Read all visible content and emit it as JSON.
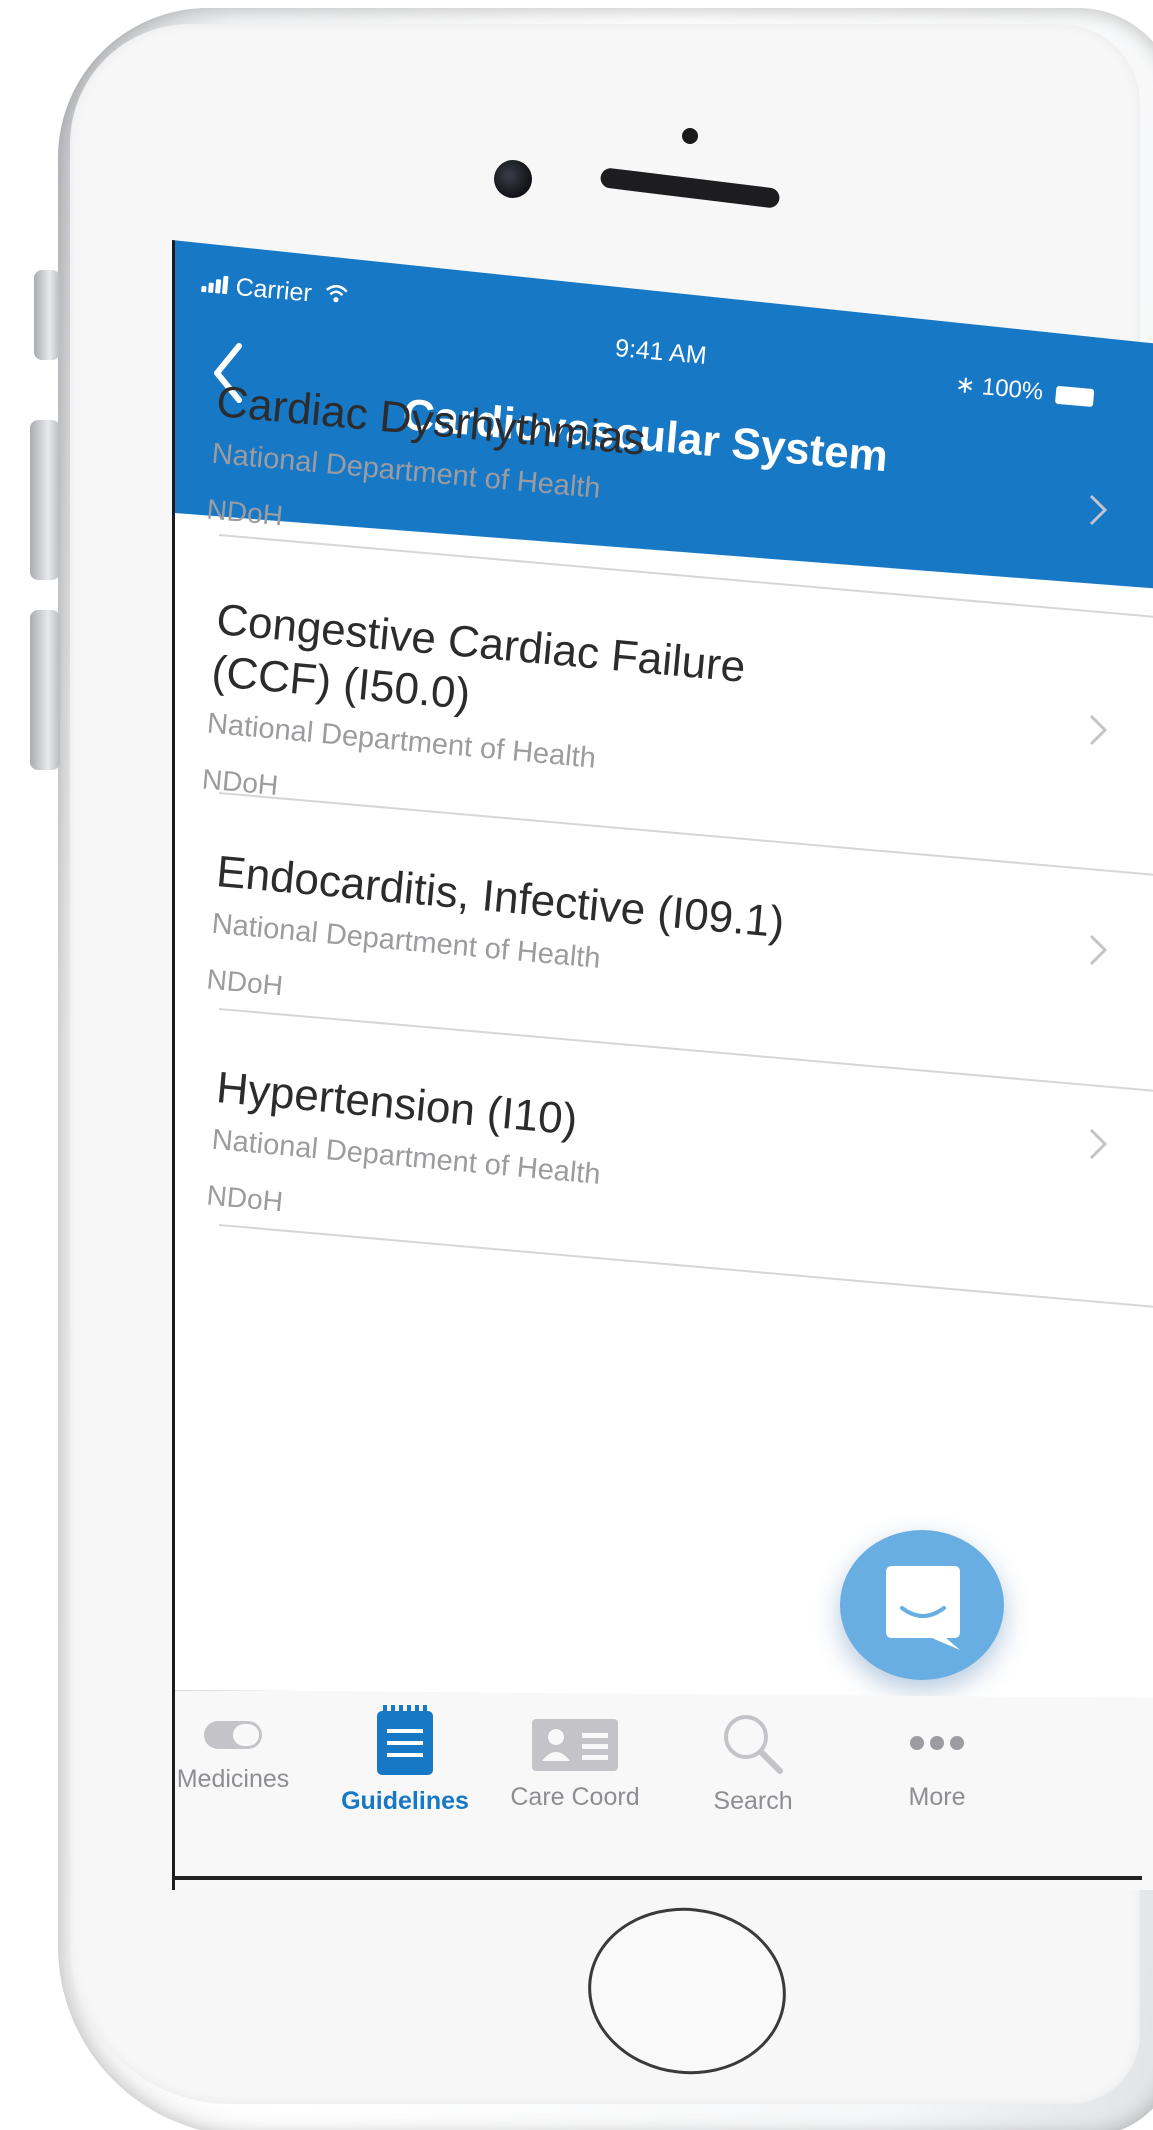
{
  "status_bar": {
    "carrier": "Carrier",
    "time": "9:41 AM",
    "battery": "100%"
  },
  "nav": {
    "title": "Cardiovascular System"
  },
  "list": {
    "items": [
      {
        "title": "Cardiac Dysrhythmias",
        "subtitle": "National Department of Health",
        "abbr": "NDoH"
      },
      {
        "title": "Congestive Cardiac Failure (CCF) (I50.0)",
        "subtitle": "National Department of Health",
        "abbr": "NDoH"
      },
      {
        "title": "Endocarditis, Infective (I09.1)",
        "subtitle": "National Department of Health",
        "abbr": "NDoH"
      },
      {
        "title": "Hypertension (I10)",
        "subtitle": "National Department of Health",
        "abbr": "NDoH"
      }
    ]
  },
  "tabs": [
    {
      "label": "Medicines",
      "icon": "pill-icon",
      "active": false
    },
    {
      "label": "Guidelines",
      "icon": "notepad-icon",
      "active": true
    },
    {
      "label": "Care Coord",
      "icon": "id-card-icon",
      "active": false
    },
    {
      "label": "Search",
      "icon": "search-icon",
      "active": false
    },
    {
      "label": "More",
      "icon": "ellipsis-icon",
      "active": false
    }
  ],
  "colors": {
    "header": "#1778c6",
    "active_tab": "#1778c6",
    "inactive_tab": "#8e8e92",
    "fab": "#69aee3"
  }
}
